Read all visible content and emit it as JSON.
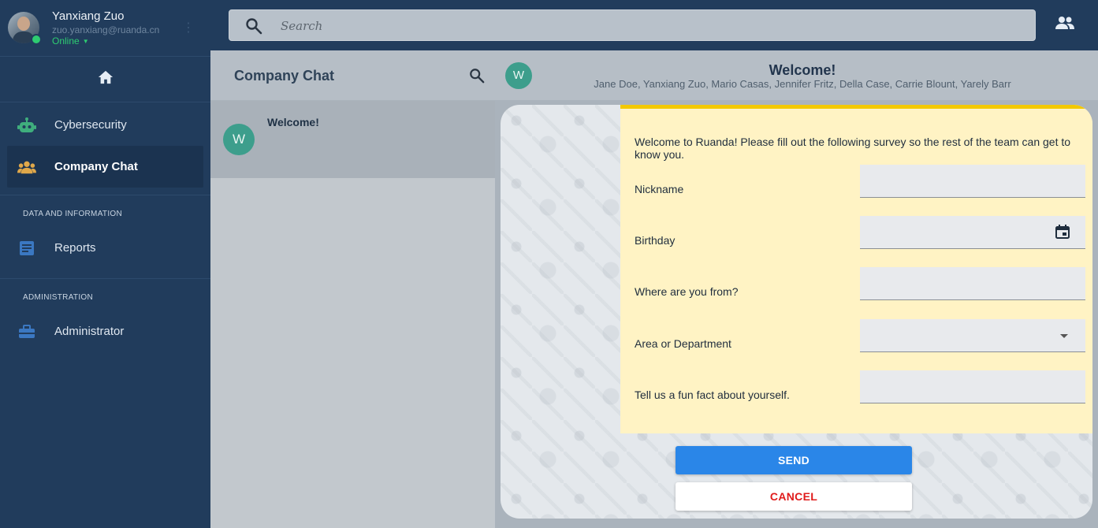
{
  "user": {
    "name": "Yanxiang Zuo",
    "email": "zuo.yanxiang@ruanda.cn",
    "status": "Online"
  },
  "sidebar": {
    "items": [
      {
        "label": "Cybersecurity",
        "icon": "robot-icon",
        "color": "#3fae7d"
      },
      {
        "label": "Company Chat",
        "icon": "people-icon",
        "color": "#e0a84a",
        "active": true
      }
    ],
    "sections": [
      {
        "label": "DATA AND INFORMATION",
        "items": [
          {
            "label": "Reports",
            "icon": "document-icon",
            "color": "#3b78c2"
          }
        ]
      },
      {
        "label": "ADMINISTRATION",
        "items": [
          {
            "label": "Administrator",
            "icon": "toolbox-icon",
            "color": "#3b78c2"
          }
        ]
      }
    ]
  },
  "search": {
    "placeholder": "Search"
  },
  "chatlist": {
    "title": "Company Chat",
    "chats": [
      {
        "initial": "W",
        "name": "Welcome!"
      }
    ]
  },
  "conversation": {
    "initial": "W",
    "title": "Welcome!",
    "members": "Jane Doe, Yanxiang Zuo, Mario Casas, Jennifer Fritz, Della Case, Carrie Blount, Yarely Barr"
  },
  "form": {
    "intro": "Welcome to Ruanda! Please fill out the following survey so the rest of the team can get to know you.",
    "fields": [
      {
        "label": "Nickname",
        "value": ""
      },
      {
        "label": "Birthday",
        "value": ""
      },
      {
        "label": "Where are you from?",
        "value": ""
      },
      {
        "label": "Area or Department",
        "value": ""
      },
      {
        "label": "Tell us a fun fact about yourself.",
        "value": ""
      }
    ],
    "send_label": "SEND",
    "cancel_label": "CANCEL"
  },
  "colors": {
    "sidebar_bg": "#213c5c",
    "accent": "#2a86e8",
    "online": "#2ecc71",
    "form_bg": "#fff3c4",
    "form_border": "#f2c800",
    "cancel_text": "#e01b1b",
    "avatar_teal": "#3d9e8c"
  }
}
